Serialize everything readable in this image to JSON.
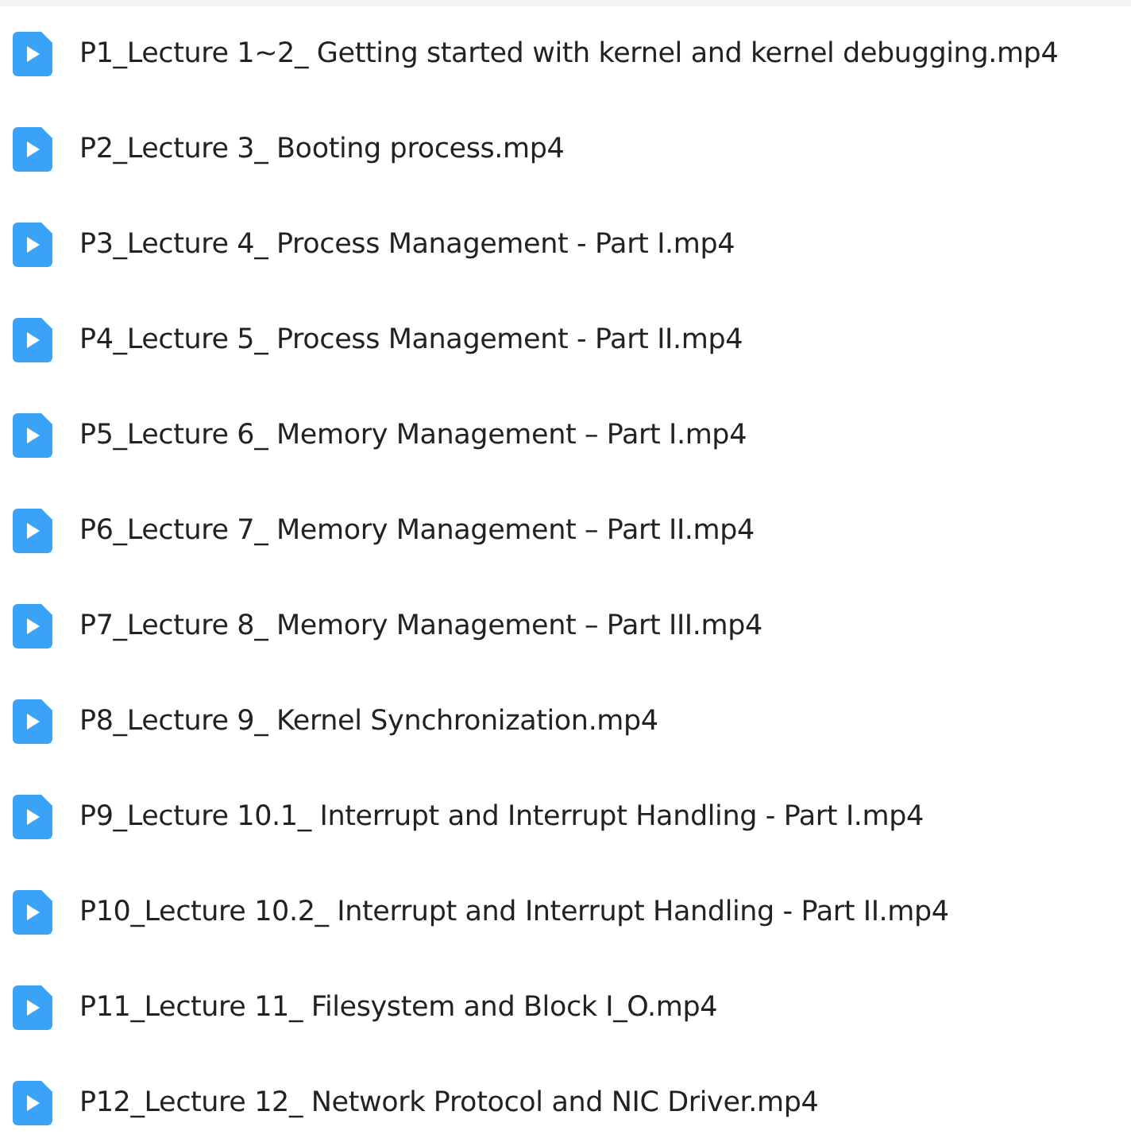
{
  "files": [
    {
      "name": "P1_Lecture 1~2_ Getting started with kernel and kernel debugging.mp4"
    },
    {
      "name": "P2_Lecture 3_ Booting process.mp4"
    },
    {
      "name": "P3_Lecture 4_ Process Management - Part I.mp4"
    },
    {
      "name": "P4_Lecture 5_ Process Management - Part II.mp4"
    },
    {
      "name": "P5_Lecture 6_ Memory Management – Part I.mp4"
    },
    {
      "name": "P6_Lecture 7_ Memory Management – Part II.mp4"
    },
    {
      "name": "P7_Lecture 8_ Memory Management – Part III.mp4"
    },
    {
      "name": "P8_Lecture 9_ Kernel Synchronization.mp4"
    },
    {
      "name": "P9_Lecture 10.1_ Interrupt and Interrupt Handling - Part I.mp4"
    },
    {
      "name": "P10_Lecture 10.2_ Interrupt and Interrupt Handling - Part II.mp4"
    },
    {
      "name": "P11_Lecture 11_ Filesystem and Block I_O.mp4"
    },
    {
      "name": "P12_Lecture 12_ Network Protocol and NIC Driver.mp4"
    }
  ]
}
